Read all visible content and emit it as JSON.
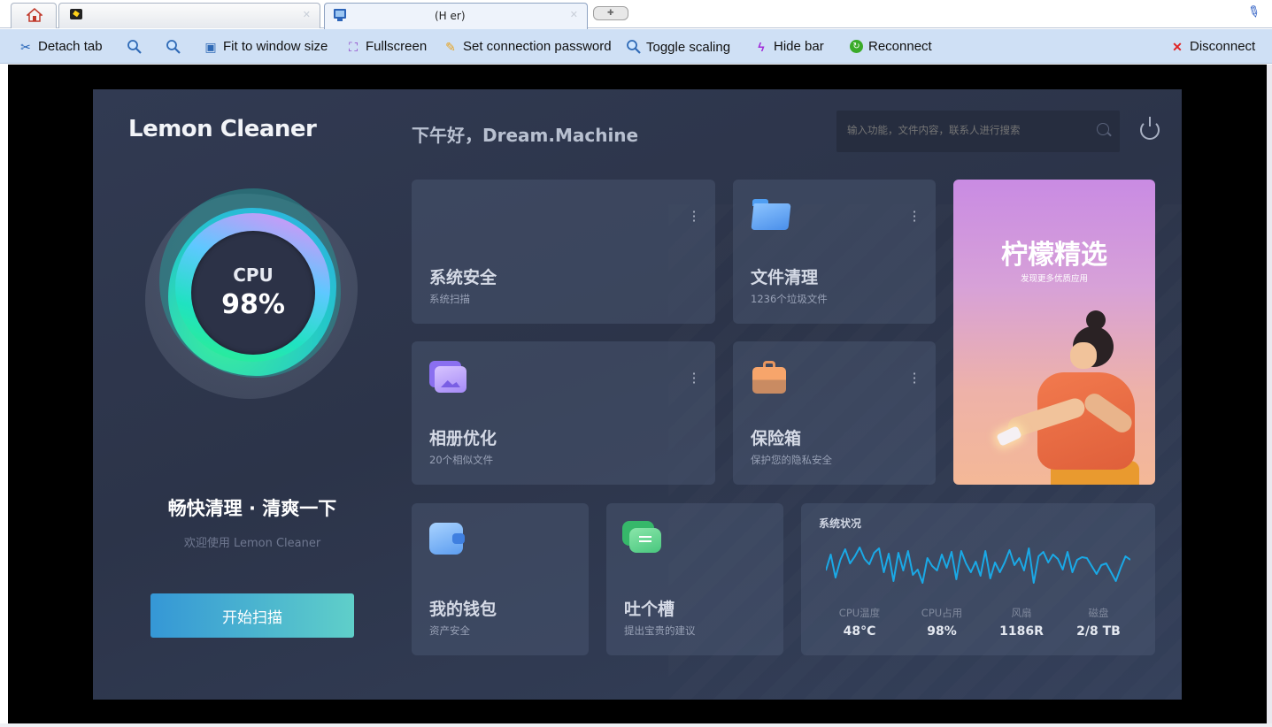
{
  "browser": {
    "tabs": [
      {
        "title": ""
      },
      {
        "title": ""
      },
      {
        "title": "(H          er)"
      }
    ]
  },
  "toolbar": {
    "detach_tab": "Detach tab",
    "fit": "Fit to window size",
    "fullscreen": "Fullscreen",
    "set_password": "Set connection password",
    "toggle_scaling": "Toggle scaling",
    "hide_bar": "Hide bar",
    "reconnect": "Reconnect",
    "disconnect": "Disconnect"
  },
  "app": {
    "logo": "Lemon Cleaner",
    "greeting": "下午好，Dream.Machine",
    "search_placeholder": "输入功能，文件内容，联系人进行搜索",
    "cpu": {
      "label": "CPU",
      "value": "98%"
    },
    "tagline": "畅快清理 · 清爽一下",
    "welcome": "欢迎使用 Lemon Cleaner",
    "scan_button": "开始扫描",
    "cards": {
      "security": {
        "title": "系统安全",
        "sub": "系统扫描"
      },
      "files": {
        "title": "文件清理",
        "sub": "1236个垃圾文件"
      },
      "photos": {
        "title": "相册优化",
        "sub": "20个相似文件"
      },
      "safe": {
        "title": "保险箱",
        "sub": "保护您的隐私安全"
      },
      "wallet": {
        "title": "我的钱包",
        "sub": "资产安全"
      },
      "feedback": {
        "title": "吐个槽",
        "sub": "提出宝贵的建议"
      }
    },
    "promo": {
      "title": "柠檬精选",
      "sub": "发现更多优质应用"
    },
    "status": {
      "title": "系统状况",
      "metrics": [
        {
          "label": "CPU温度",
          "value": "48°C"
        },
        {
          "label": "CPU占用",
          "value": "98%"
        },
        {
          "label": "风扇",
          "value": "1186R"
        },
        {
          "label": "磁盘",
          "value": "2/8 TB"
        }
      ],
      "sparkline": [
        22,
        40,
        14,
        34,
        46,
        30,
        38,
        48,
        35,
        29,
        42,
        47,
        20,
        41,
        10,
        42,
        22,
        44,
        17,
        23,
        8,
        36,
        27,
        22,
        40,
        25,
        43,
        12,
        44,
        30,
        20,
        32,
        16,
        44,
        13,
        31,
        20,
        31,
        45,
        28,
        36,
        22,
        47,
        8,
        38,
        43,
        31,
        40,
        35,
        23,
        43,
        20,
        34,
        37,
        36,
        27,
        18,
        28,
        30,
        20,
        10,
        25,
        38,
        34
      ],
      "line_color": "#1aa9e6"
    }
  }
}
